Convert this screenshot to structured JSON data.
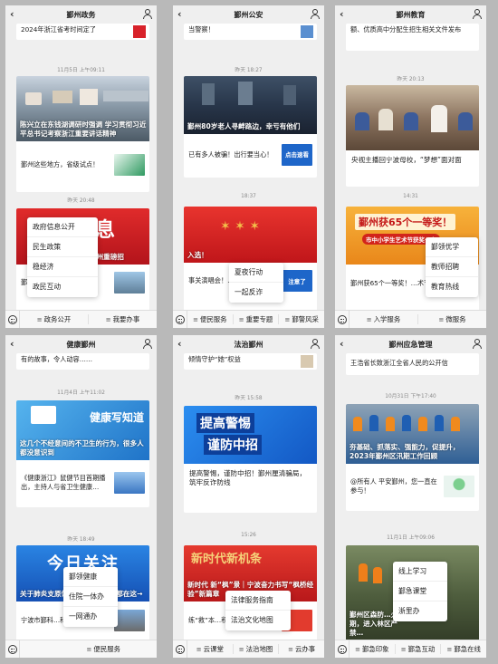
{
  "colors": {
    "wechat_bg": "#efefef",
    "gov_red": "#d8222a",
    "edu_orange": "#f29a1d",
    "blue": "#1d6fd1"
  },
  "panels": [
    {
      "title": "鄞州政务",
      "top_snippet": "2024年浙江省考时间定了",
      "ts1": "11月5日 上午09:11",
      "headline": "陈兴立在东钱湖调研时强调 学习贯彻习近平总书记考察浙江重要讲话精神",
      "item1": "鄞州这些地方，省级试点！",
      "ts2": "昨天 20:48",
      "banner2_text": "重要消息",
      "banner2_cap": "鄞州重磅招",
      "item2": "鄞州…用",
      "popup": [
        "政府信息公开",
        "民生政策",
        "稳经济",
        "政民互动"
      ],
      "tabs": [
        "政务公开",
        "我要办事"
      ]
    },
    {
      "title": "鄞州公安",
      "top_snippet": "当警察！",
      "ts1": "昨天 18:27",
      "headline": "鄞州80岁老人寻衅路边，幸亏有他们",
      "item1": "已有多人被骗！出行要当心！",
      "thumb1": "点击速看",
      "ts2": "18:37",
      "banner2_cap": "入选！",
      "item2": "事关演唱会！…请立即报警！",
      "thumb2": "注意了",
      "popup": [
        "夏夜行动",
        "一起反诈"
      ],
      "tabs": [
        "便民服务",
        "重要专题",
        "鄞警风采"
      ]
    },
    {
      "title": "鄞州教育",
      "top_snippet": "额、优质高中分配生招生相关文件发布",
      "ts1": "昨天 20:13",
      "item1": "央视主播回宁波母校，“梦想”面对面",
      "ts2": "14:31",
      "banner2_title": "鄞州获65个一等奖！",
      "banner2_sub": "市中小学生艺术节获奖公布",
      "item2": "鄞州获65个一等奖！…术节获奖名单公布",
      "popup": [
        "鄞领优学",
        "教师招聘",
        "教育热线"
      ],
      "tabs": [
        "入学服务",
        "微服务"
      ]
    },
    {
      "title": "健康鄞州",
      "top_snippet": "有的故事，令人动容……",
      "ts1": "11月4日 上午11:02",
      "banner1_text": "健康写知道",
      "headline": "这几个不经意间的不卫生的行为，很多人都没意识到",
      "item1": "《健康浙江》鼠健节目首期播出，主持人与省卫生健康…",
      "ts2": "昨天 18:49",
      "banner2_text": "今日关注",
      "banner2_cap": "关于肺炎支原体感染…五大问题都在这→",
      "item2": "宁波市鄞科…科研工作站正",
      "popup": [
        "鄞领健康",
        "住院一体办",
        "一网通办"
      ],
      "tabs": [
        "便民服务"
      ]
    },
    {
      "title": "法治鄞州",
      "top_snippet": "倾情守护“她”权益",
      "ts1": "昨天 15:58",
      "banner1_l1": "提高警惕",
      "banner1_l2": "谨防中招",
      "item1": "提高警惕，谨防中招！鄞州厘清骗局，筑牢反诈防线",
      "ts2": "15:26",
      "banner2_text": "新时代新机条",
      "banner2_cap": "新时代 新“枫”景｜宁波奋力书写“枫桥经验”新篇章",
      "item2": "练“救”本…积开展社区",
      "popup": [
        "法律服务指南",
        "法治文化地图"
      ],
      "tabs": [
        "云课堂",
        "法治地图",
        "云办事"
      ]
    },
    {
      "title": "鄞州应急管理",
      "top_snippet": "王浩省长致浙江全省人民的公开信",
      "ts1": "10月31日 下午17:40",
      "headline": "夯基础、抓落实、强能力，促提升，2023年鄞州区汛期工作回顾",
      "item1": "@所有人 平安鄞州，您一直在参与！",
      "ts2": "11月1日 上午09:06",
      "headline2": "鄞州区森防…火期，进入林区严禁…",
      "popup": [
        "线上学习",
        "鄞急课堂",
        "浙里办"
      ],
      "tabs": [
        "鄞急印象",
        "鄞急互动",
        "鄞急在线"
      ]
    }
  ]
}
